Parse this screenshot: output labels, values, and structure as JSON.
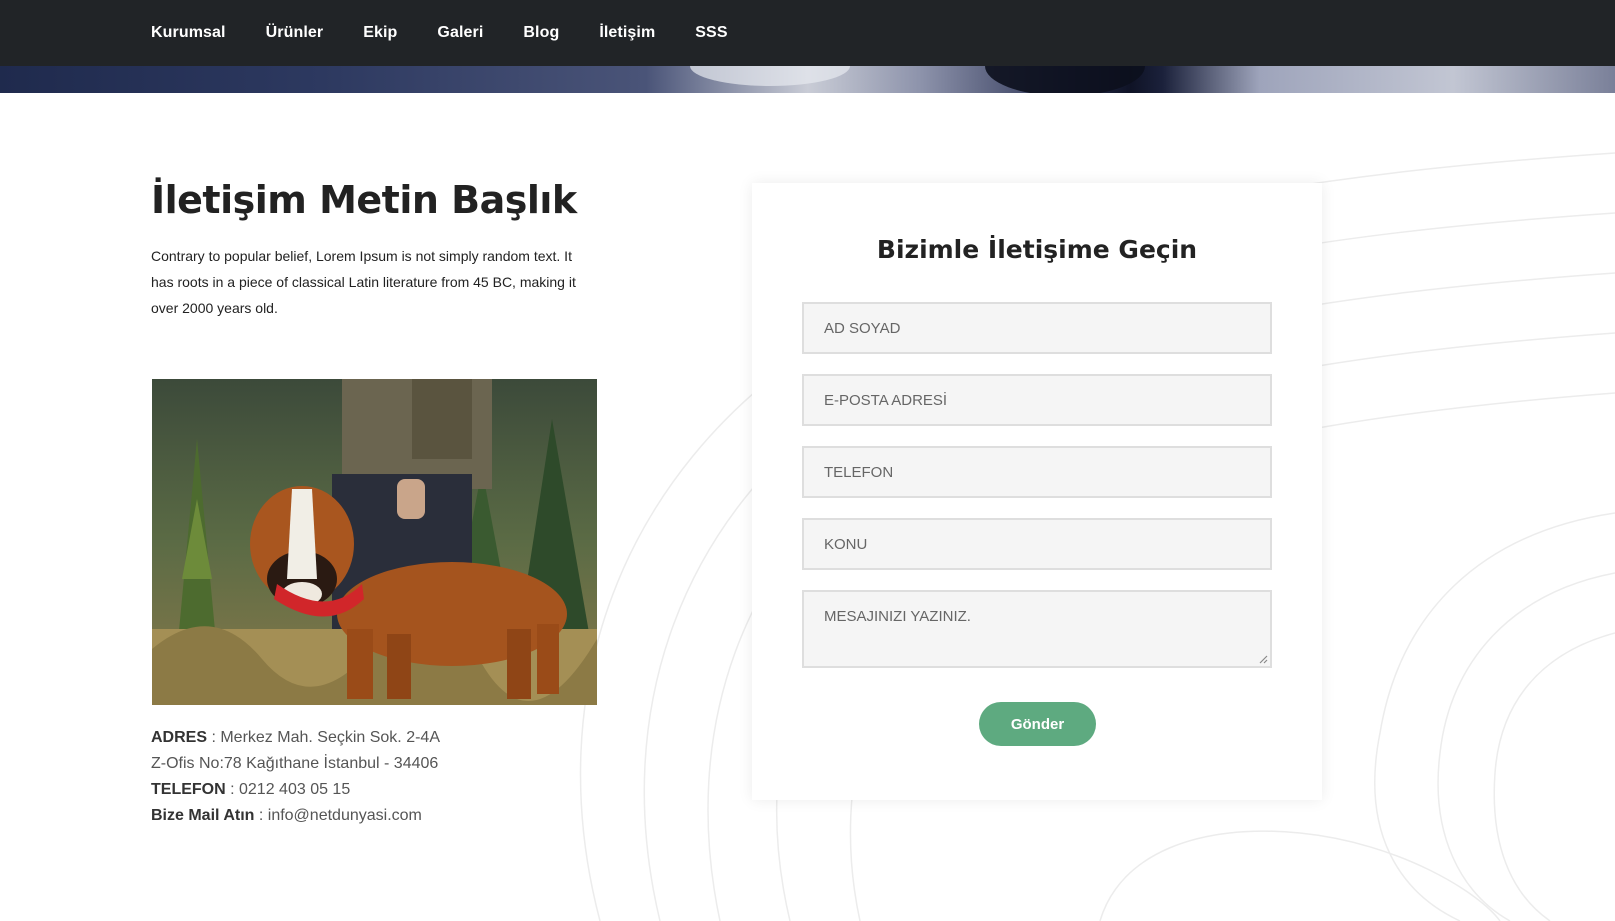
{
  "nav": {
    "items": [
      "Kurumsal",
      "Ürünler",
      "Ekip",
      "Galeri",
      "Blog",
      "İletişim",
      "SSS"
    ]
  },
  "contact": {
    "heading": "İletişim Metin Başlık",
    "intro": "Contrary to popular belief, Lorem Ipsum is not simply random text. It has roots in a piece of classical Latin literature from 45 BC, making it over 2000 years old.",
    "address_label": "ADRES",
    "address_line1": " : Merkez Mah. Seçkin Sok. 2-4A",
    "address_line2": "Z-Ofis No:78 Kağıthane İstanbul - 34406",
    "phone_label": "TELEFON",
    "phone_value": " : 0212 403 05 15",
    "mail_label": "Bize Mail Atın",
    "mail_value": " : info@netdunyasi.com"
  },
  "form": {
    "title": "Bizimle İletişime Geçin",
    "name_placeholder": "AD SOYAD",
    "email_placeholder": "E-POSTA ADRESİ",
    "phone_placeholder": "TELEFON",
    "subject_placeholder": "KONU",
    "message_placeholder": "MESAJINIZI YAZINIZ.",
    "submit_label": "Gönder"
  },
  "colors": {
    "navbar": "#212427",
    "accent": "#5eaa80"
  }
}
